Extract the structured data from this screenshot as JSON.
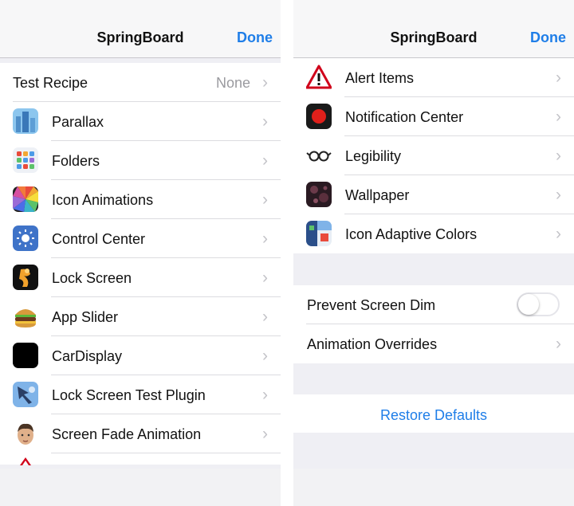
{
  "left_screen": {
    "nav": {
      "title": "SpringBoard",
      "done_label": "Done"
    },
    "test_recipe": {
      "label": "Test Recipe",
      "value": "None"
    },
    "items": [
      {
        "label": "Parallax",
        "icon": "parallax-icon"
      },
      {
        "label": "Folders",
        "icon": "folders-icon"
      },
      {
        "label": "Icon Animations",
        "icon": "icon-animations-icon"
      },
      {
        "label": "Control Center",
        "icon": "control-center-icon"
      },
      {
        "label": "Lock Screen",
        "icon": "lock-screen-icon"
      },
      {
        "label": "App Slider",
        "icon": "burger-icon"
      },
      {
        "label": "CarDisplay",
        "icon": "cardisplay-icon"
      },
      {
        "label": "Lock Screen Test Plugin",
        "icon": "test-plugin-icon"
      },
      {
        "label": "Screen Fade Animation",
        "icon": "face-icon"
      }
    ]
  },
  "right_screen": {
    "nav": {
      "title": "SpringBoard",
      "done_label": "Done"
    },
    "items": [
      {
        "label": "Alert Items",
        "icon": "warning-icon"
      },
      {
        "label": "Notification Center",
        "icon": "record-icon"
      },
      {
        "label": "Legibility",
        "icon": "glasses-icon"
      },
      {
        "label": "Wallpaper",
        "icon": "wallpaper-icon"
      },
      {
        "label": "Icon Adaptive Colors",
        "icon": "adaptive-colors-icon"
      }
    ],
    "prevent_screen_dim": {
      "label": "Prevent Screen Dim",
      "enabled": false
    },
    "animation_overrides": {
      "label": "Animation Overrides"
    },
    "restore_label": "Restore Defaults"
  },
  "colors": {
    "accent": "#1f7ee8",
    "background": "#efeff4",
    "alert_red": "#d0021b"
  }
}
